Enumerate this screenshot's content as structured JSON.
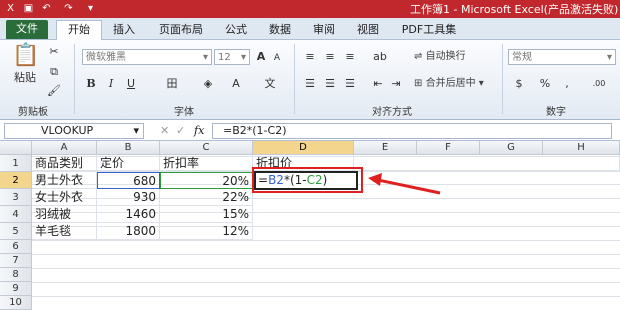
{
  "window": {
    "title": "工作簿1 - Microsoft Excel(产品激活失败)"
  },
  "ribbon_tabs": [
    "文件",
    "开始",
    "插入",
    "页面布局",
    "公式",
    "数据",
    "审阅",
    "视图",
    "PDF工具集"
  ],
  "ribbon": {
    "paste_label": "粘贴",
    "font_name": "微软雅黑",
    "font_size": "12",
    "wrap_text": "自动换行",
    "merge_center": "合并后居中",
    "number_format": "常规",
    "groups": {
      "clipboard": "剪贴板",
      "font": "字体",
      "alignment": "对齐方式",
      "number": "数字"
    }
  },
  "formula_bar": {
    "name_box": "VLOOKUP",
    "formula": "=B2*(1-C2)",
    "fx": "fx"
  },
  "sheet": {
    "columns": [
      "A",
      "B",
      "C",
      "D",
      "E",
      "F",
      "G",
      "H"
    ],
    "rows": [
      "1",
      "2",
      "3",
      "4",
      "5",
      "6",
      "7",
      "8",
      "9",
      "10"
    ],
    "cells": {
      "A1": "商品类别",
      "B1": "定价",
      "C1": "折扣率",
      "D1": "折扣价",
      "A2": "男士外衣",
      "B2": "680",
      "C2": "20%",
      "A3": "女士外衣",
      "B3": "930",
      "C3": "22%",
      "A4": "羽绒被",
      "B4": "1460",
      "C4": "15%",
      "A5": "羊毛毯",
      "B5": "1800",
      "C5": "12%"
    },
    "editing_cell": {
      "eq": "=",
      "ref1": "B2",
      "mid": "*(1-",
      "ref2": "C2",
      "end": ")"
    }
  },
  "colors": {
    "title_bar": "#c0282d",
    "ref1": "#3a5fd0",
    "ref2": "#2e9b3e",
    "annotation": "#e02020"
  }
}
